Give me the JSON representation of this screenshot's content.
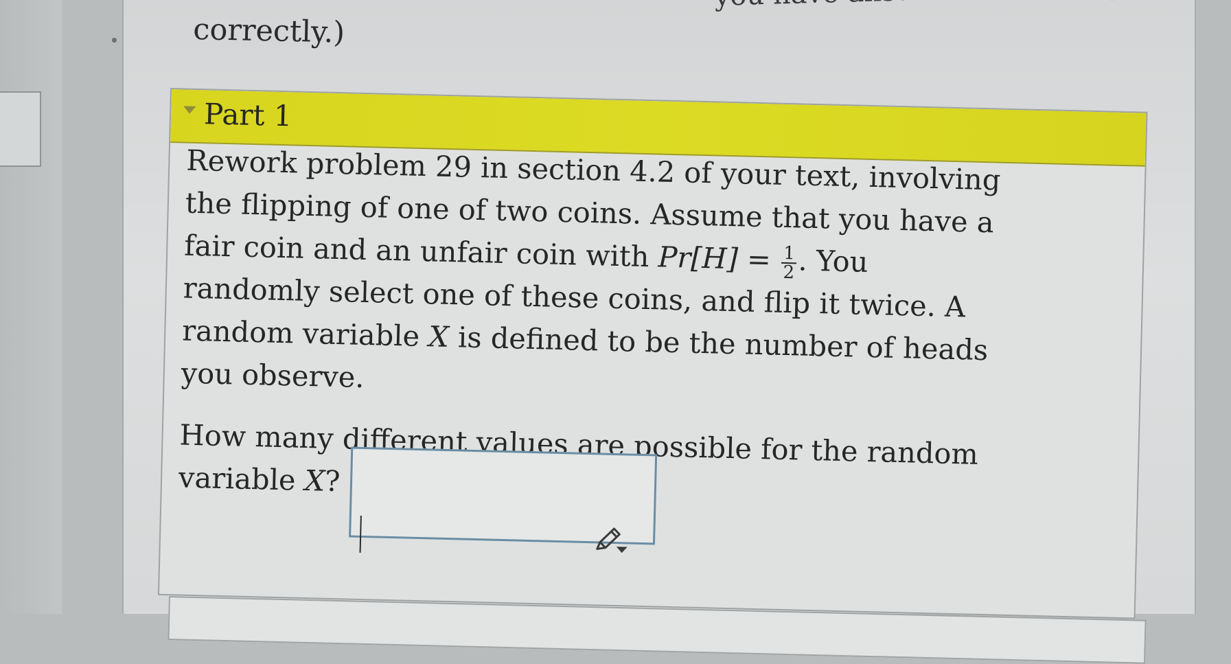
{
  "context": {
    "top_text": "you have answered the first part",
    "continuation": "correctly.)"
  },
  "part": {
    "title": "Part 1"
  },
  "problem": {
    "line1": "Rework problem 29 in section 4.2 of your text, involving",
    "line2": "the flipping of one of two coins. Assume that you have a",
    "line3_pre": "fair coin and an unfair coin with ",
    "math_lhs": "Pr[H]",
    "math_eq": " = ",
    "frac_num": "1",
    "frac_den": "2",
    "line3_post": ". You",
    "line4": "randomly select one of these coins, and flip it twice. A",
    "line5_pre": "random variable ",
    "var_x": "X",
    "line5_post": " is defined to be the number of heads",
    "line6": "you observe."
  },
  "question": {
    "line1": "How many different values are possible for the random",
    "line2_pre": "variable ",
    "var_x": "X",
    "line2_post": "?"
  },
  "answer": {
    "value": ""
  },
  "icons": {
    "edit": "pencil-icon",
    "collapse": "triangle-down-icon"
  },
  "colors": {
    "header_yellow": "#dcdb24",
    "input_border": "#6a8da5"
  }
}
